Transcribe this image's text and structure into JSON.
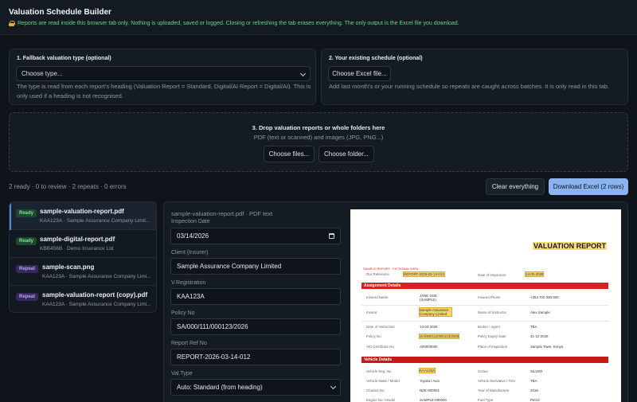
{
  "app": {
    "title": "Valuation Schedule Builder",
    "privacy_notice": "Reports are read inside this browser tab only. Nothing is uploaded, saved or logged. Closing or refreshing the tab erases everything. The only output is the Excel file you download."
  },
  "fallback": {
    "title": "1. Fallback valuation type (optional)",
    "select_value": "Choose type...",
    "help": "The type is read from each report's heading (Valuation Report = Standard, Digital/AI Report = Digital/AI). This is only used if a heading is not recognised."
  },
  "existing": {
    "title": "2. Your existing schedule (optional)",
    "button": "Choose Excel file...",
    "help": "Add last month's or your running schedule so repeats are caught across batches. It is only read in this tab."
  },
  "dropzone": {
    "title": "3. Drop valuation reports or whole folders here",
    "subtitle": "PDF (text or scanned) and images (JPG, PNG...)",
    "choose_files": "Choose files...",
    "choose_folder": "Choose folder..."
  },
  "status": {
    "summary": "2 ready · 0 to review · 2 repeats · 0 errors",
    "clear_button": "Clear everything",
    "download_button": "Download Excel (2 rows)"
  },
  "files": [
    {
      "badge": "Ready",
      "name": "sample-valuation-report.pdf",
      "meta": "KAA123A · Sample Assurance Company Limit..."
    },
    {
      "badge": "Ready",
      "name": "sample-digital-report.pdf",
      "meta": "KBB456B · Demo Insurance Ltd"
    },
    {
      "badge": "Repeat",
      "name": "sample-scan.png",
      "meta": "KAA123A · Sample Assurance Company Limi..."
    },
    {
      "badge": "Repeat",
      "name": "sample-valuation-report (copy).pdf",
      "meta": "KAA123A · Sample Assurance Company Limi..."
    }
  ],
  "detail": {
    "file_title": "sample-valuation-report.pdf · PDF text",
    "fields": {
      "inspection_date_label": "Inspection Date",
      "inspection_date": "03/14/2026",
      "client_label": "Client (Insurer)",
      "client": "Sample Assurance Company Limited",
      "registration_label": "V.Registration",
      "registration": "KAA123A",
      "policy_label": "Policy No",
      "policy": "SA/000/111/000123/2026",
      "report_ref_label": "Report Ref No",
      "report_ref": "REPORT-2026-03-14-012",
      "valtype_label": "Val.Type",
      "valtype": "Auto: Standard (from heading)"
    }
  },
  "document": {
    "title": "VALUATION REPORT",
    "sample_note": "SAMPLE REPORT - FICTIONAL DATA",
    "our_reference_label": "Our Reference",
    "our_reference": "REPORT-2026-03-14-012",
    "date_of_inspection_label": "Date of Inspection",
    "date_of_inspection": "14-03-2026",
    "assignment_heading": "Assignment Details",
    "insured_name_label": "Insured Name",
    "insured_name": "JANE DOE (SAMPLE)",
    "insured_phone_label": "Insured Phone",
    "insured_phone": "+254 700 000 000",
    "insurer_label": "Insurer",
    "insurer": "Sample Assurance Company Limited",
    "instructor_label": "Name of Instructor",
    "instructor": "Alex Sample",
    "date_instruction_label": "Date of Instruction",
    "date_instruction": "14-03-2026",
    "broker_label": "Broker / Agent",
    "broker": "TBA",
    "policy_label": "Policy No",
    "policy": "SA/000/111/000123/2026",
    "policy_expiry_label": "Policy Expiry Date",
    "policy_expiry": "31-12-2026",
    "aki_label": "AKI Certificate No",
    "aki": "A00000000",
    "place_label": "Place of Inspection",
    "place": "Sample Town, Kenya",
    "vehicle_heading": "Vehicle Details",
    "reg_label": "Vehicle Reg. No",
    "reg": "KAA123A",
    "colour_label": "Colour",
    "colour": "SILVER",
    "make_label": "Vehicle Make / Model",
    "make": "Toyota / Axio",
    "derivative_label": "Vehicle Derivative / Trim",
    "derivative": "TBA",
    "chassis_label": "Chassis No",
    "chassis": "NZE-000001",
    "yom_label": "Year of Manufacture",
    "yom": "2016",
    "engine_label": "Engine No / Model",
    "engine": "SAMPLE-000000",
    "fuel_label": "Fuel Type",
    "fuel": "Petrol"
  },
  "colors": {
    "accent": "#8ab4f0",
    "ready_badge": "#1c4a2f",
    "repeat_badge": "#352a5b",
    "doc_red": "#d81e1e",
    "privacy_green": "#6dd28c"
  }
}
